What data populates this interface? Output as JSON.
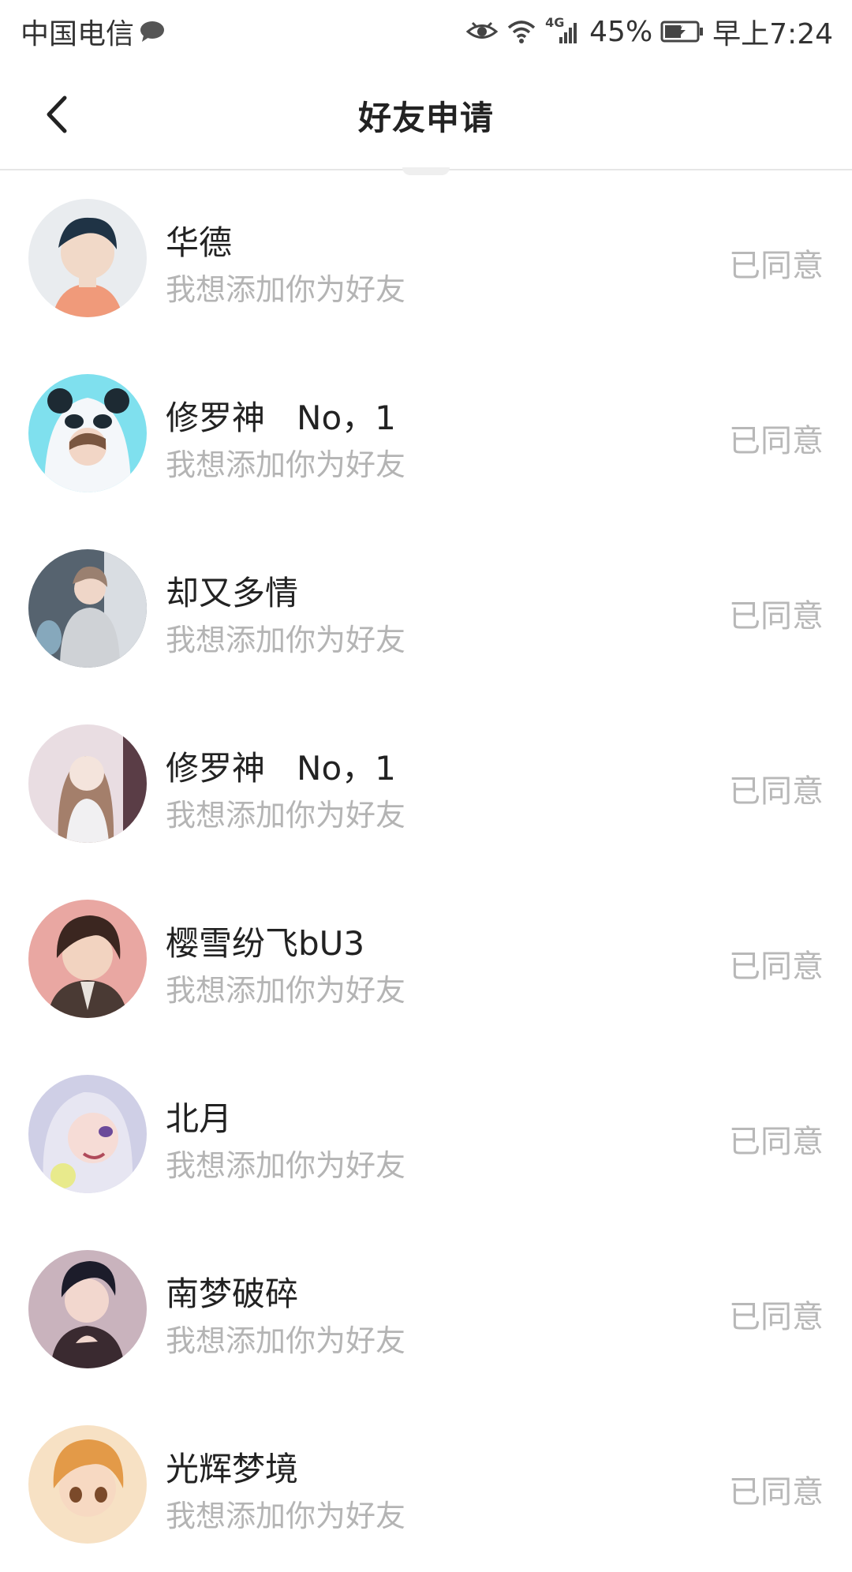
{
  "status_bar": {
    "carrier": "中国电信",
    "network": "4G",
    "battery": "45%",
    "time": "早上7:24",
    "icons": [
      "chat-bubble-icon",
      "eye-icon",
      "wifi-icon",
      "signal-icon",
      "battery-icon"
    ]
  },
  "header": {
    "title": "好友申请",
    "back_icon": "back-arrow-icon"
  },
  "requests": [
    {
      "name": "华德",
      "message": "我想添加你为好友",
      "status": "已同意"
    },
    {
      "name": "修罗神   No，1",
      "message": "我想添加你为好友",
      "status": "已同意"
    },
    {
      "name": "却又多情",
      "message": "我想添加你为好友",
      "status": "已同意"
    },
    {
      "name": "修罗神   No，1",
      "message": "我想添加你为好友",
      "status": "已同意"
    },
    {
      "name": "樱雪纷飞bU3",
      "message": "我想添加你为好友",
      "status": "已同意"
    },
    {
      "name": "北月",
      "message": "我想添加你为好友",
      "status": "已同意"
    },
    {
      "name": "南梦破碎",
      "message": "我想添加你为好友",
      "status": "已同意"
    },
    {
      "name": "光辉梦境",
      "message": "我想添加你为好友",
      "status": "已同意"
    }
  ],
  "colors": {
    "title": "#222222",
    "secondary_text": "#b4b4b4",
    "status_text": "#b8b8b8",
    "divider": "#e6e6e6"
  }
}
